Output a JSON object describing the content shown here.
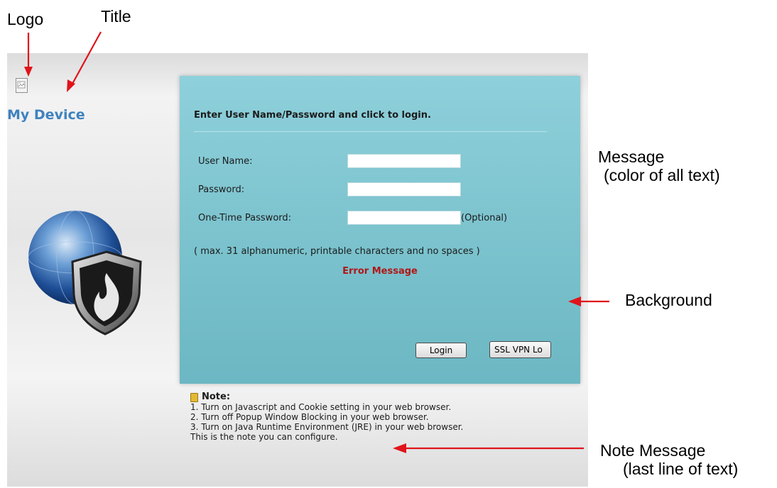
{
  "annotations": {
    "logo": "Logo",
    "title": "Title",
    "message_line1": "Message",
    "message_line2": "(color of all text)",
    "background": "Background",
    "note_message_line1": "Note Message",
    "note_message_line2": "(last line of text)",
    "arrow_color": "#e0141b"
  },
  "header": {
    "logo_icon": "broken-image-icon",
    "title": "My Device",
    "title_color": "#3f82be"
  },
  "login": {
    "heading": "Enter User Name/Password and click to login.",
    "username_label": "User Name:",
    "username_value": "",
    "password_label": "Password:",
    "password_value": "",
    "otp_label": "One-Time Password:",
    "otp_value": "",
    "otp_optional": "(Optional)",
    "hint": "( max. 31 alphanumeric, printable characters and no spaces )",
    "error_message": "Error Message",
    "error_color": "#b01717",
    "login_button": "Login",
    "ssl_vpn_button": "SSL VPN Lo",
    "panel_color": "#7fc6d1"
  },
  "note": {
    "title": "Note:",
    "icon": "note-book-icon",
    "lines": [
      "1. Turn on Javascript and Cookie setting in your web browser.",
      "2. Turn off Popup Window Blocking in your web browser.",
      "3. Turn on Java Runtime Environment (JRE) in your web browser.",
      "This is the note you can configure."
    ]
  }
}
